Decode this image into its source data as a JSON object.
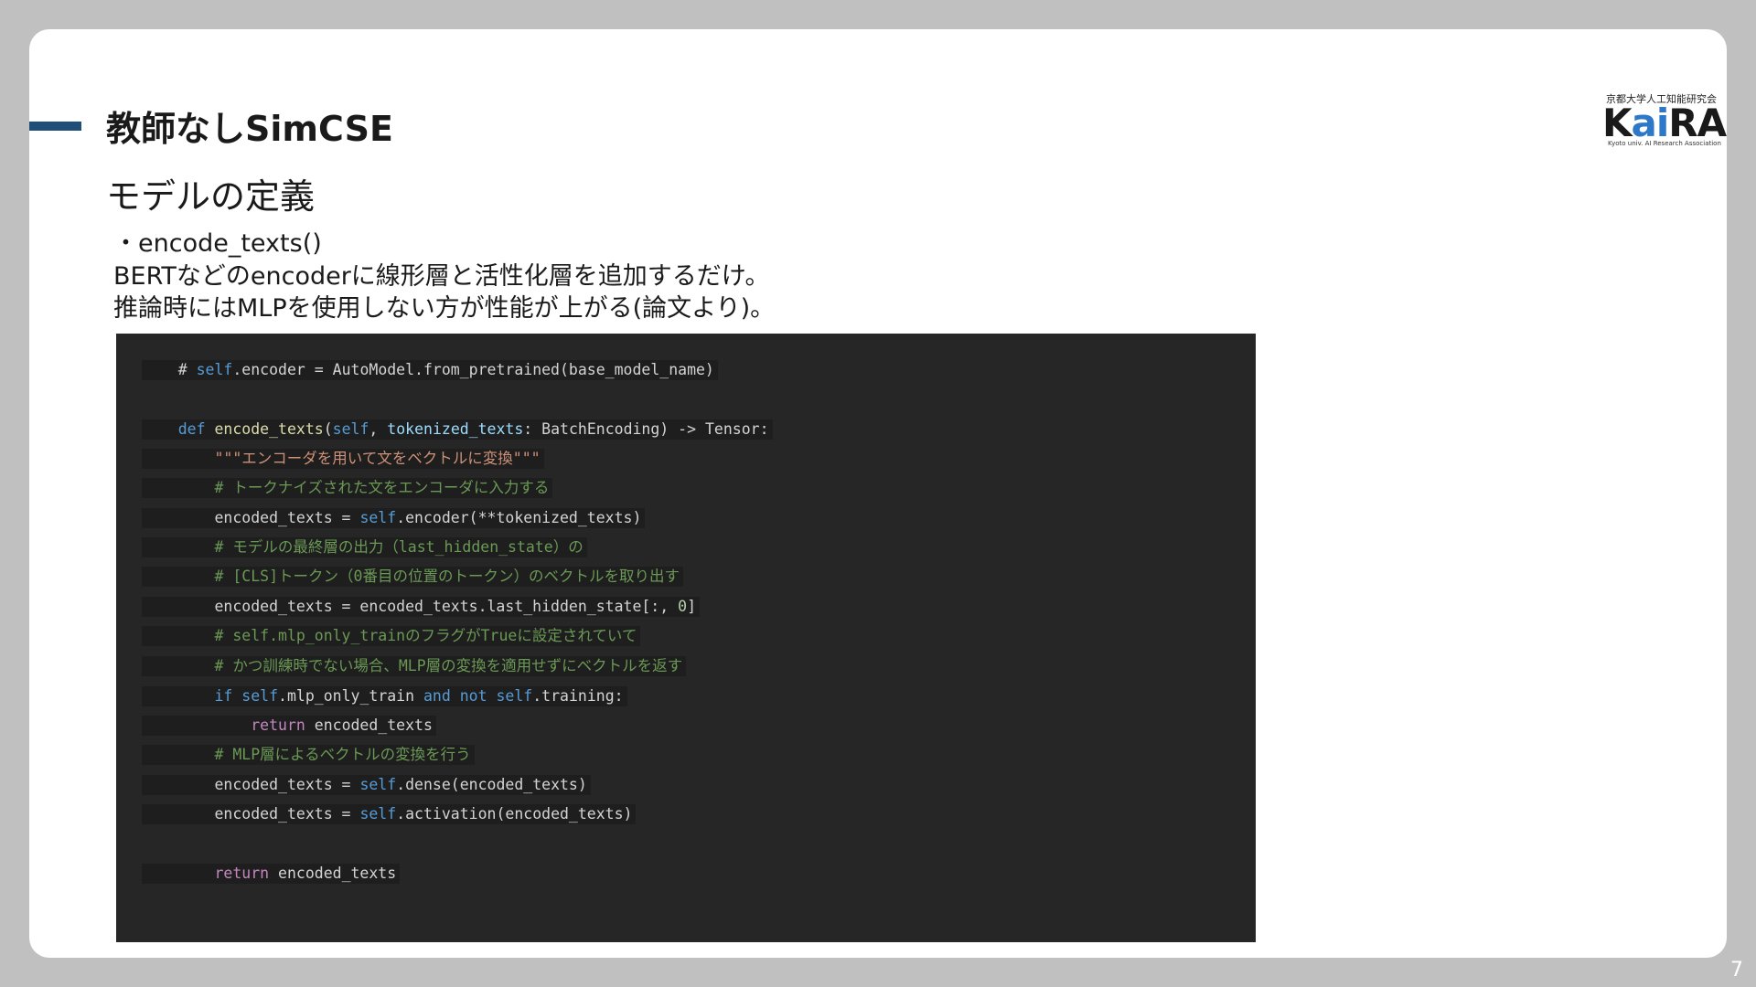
{
  "slide": {
    "title": "教師なしSimCSE",
    "subtitle": "モデルの定義",
    "bullets": [
      "・encode_texts()",
      "BERTなどのencoderに線形層と活性化層を追加するだけ。",
      "推論時にはMLPを使用しない方が性能が上がる(論文より)。"
    ],
    "page_number": "7"
  },
  "logo": {
    "japanese": "京都大学人工知能研究会",
    "mark_k": "K",
    "mark_a": "a",
    "mark_i": "i",
    "mark_ra": "RA",
    "english": "Kyoto univ. AI Research Association"
  },
  "code": {
    "l1": [
      "# ",
      "self",
      ".encoder = AutoModel.from_pretrained(base_model_name)"
    ],
    "l2": [
      "def ",
      "encode_texts",
      "(",
      "self",
      ", ",
      "tokenized_texts",
      ": BatchEncoding) -> Tensor:"
    ],
    "l3": "\"\"\"エンコーダを用いて文をベクトルに変換\"\"\"",
    "l4": "# トークナイズされた文をエンコーダに入力する",
    "l5": [
      "encoded_texts = ",
      "self",
      ".encoder(**tokenized_texts)"
    ],
    "l6": "# モデルの最終層の出力（last_hidden_state）の",
    "l7": "# [CLS]トークン（0番目の位置のトークン）のベクトルを取り出す",
    "l8": [
      "encoded_texts = encoded_texts.last_hidden_state[:, ",
      "0",
      "]"
    ],
    "l9": "# self.mlp_only_trainのフラグがTrueに設定されていて",
    "l10": "# かつ訓練時でない場合、MLP層の変換を適用せずにベクトルを返す",
    "l11": [
      "if ",
      "self",
      ".mlp_only_train ",
      "and not ",
      "self",
      ".training:"
    ],
    "l12": [
      "return ",
      "encoded_texts"
    ],
    "l13": "# MLP層によるベクトルの変換を行う",
    "l14": [
      "encoded_texts = ",
      "self",
      ".dense(encoded_texts)"
    ],
    "l15": [
      "encoded_texts = ",
      "self",
      ".activation(encoded_texts)"
    ],
    "l16": [
      "return ",
      "encoded_texts"
    ]
  }
}
